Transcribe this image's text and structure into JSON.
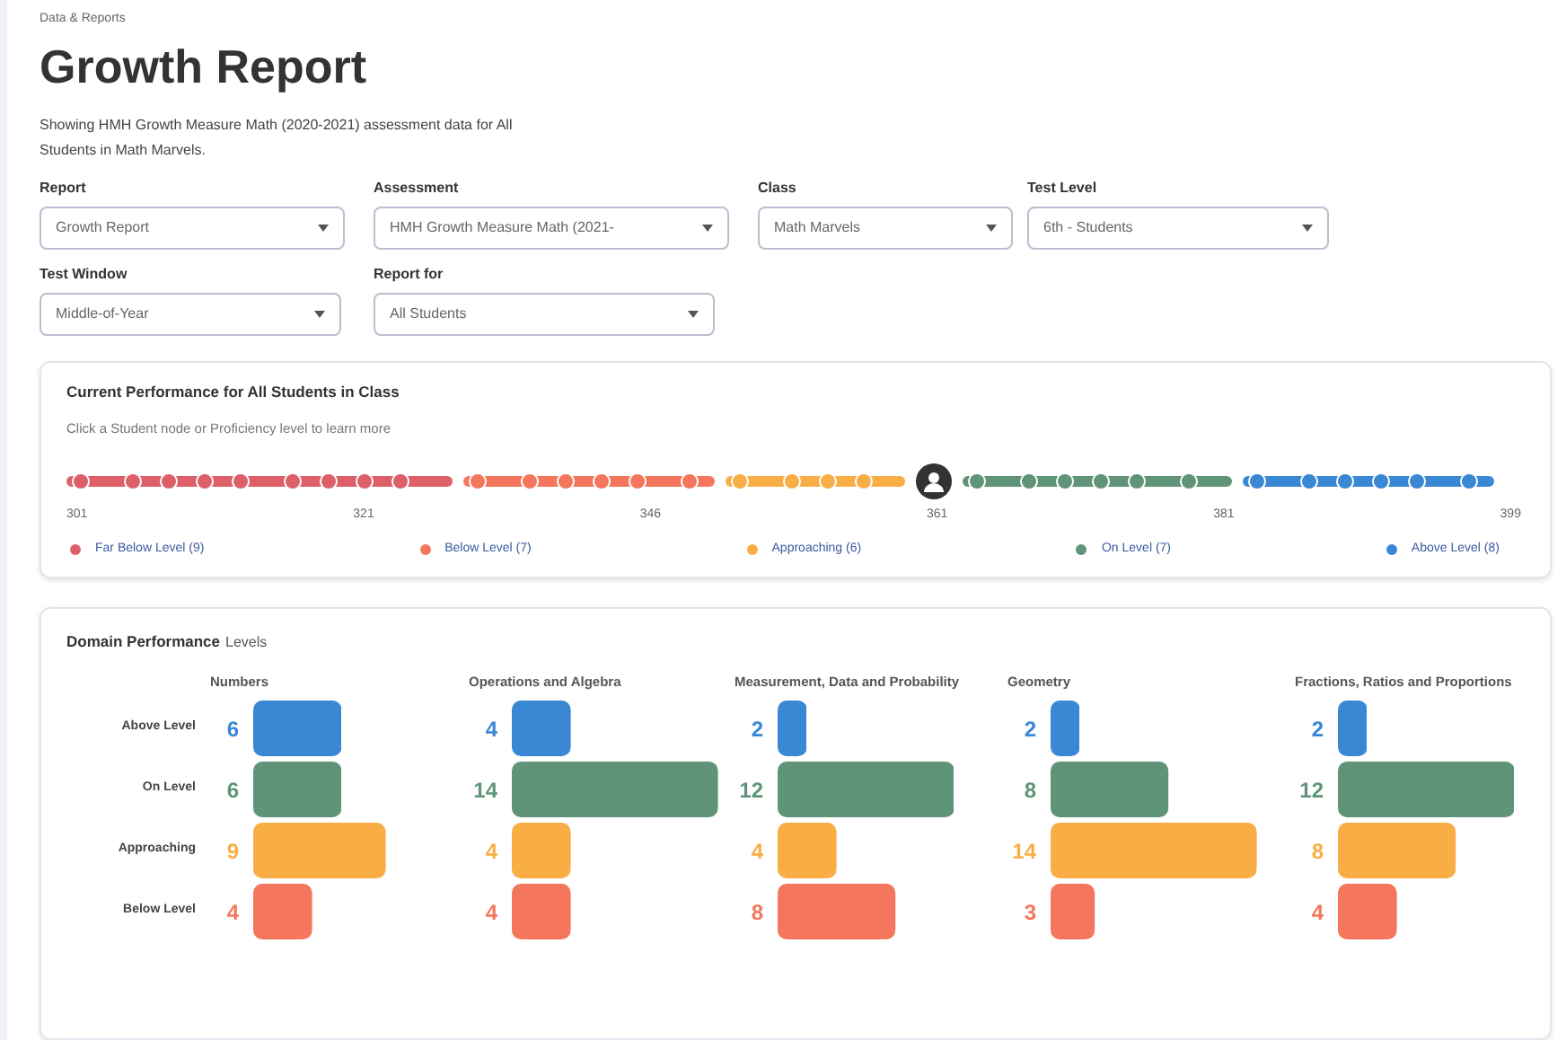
{
  "breadcrumb": "Data & Reports",
  "title": "Growth Report",
  "description": "Showing HMH Growth Measure Math (2020-2021) assessment data for All Students in Math Marvels.",
  "filters": [
    {
      "label": "Report",
      "value": "Growth Report"
    },
    {
      "label": "Assessment",
      "value": "HMH Growth Measure Math (2021-"
    },
    {
      "label": "Class",
      "value": "Math Marvels"
    },
    {
      "label": "Test Level",
      "value": "6th - Students"
    },
    {
      "label": "Test Window",
      "value": "Middle-of-Year"
    },
    {
      "label": "Report for",
      "value": "All Students"
    }
  ],
  "current_performance": {
    "title": "Current Performance for All Students in Class",
    "hint": "Click a Student node or Proficiency level to learn more",
    "axis_ticks": [
      "301",
      "321",
      "346",
      "361",
      "381",
      "399"
    ],
    "levels": [
      {
        "label": "Far Below Level (9)",
        "color": "#dd6068"
      },
      {
        "label": "Below Level (7)",
        "color": "#f4765c"
      },
      {
        "label": "Approaching (6)",
        "color": "#f9ad45"
      },
      {
        "label": "On Level (7)",
        "color": "#5f9478"
      },
      {
        "label": "Above Level (8)",
        "color": "#3a87d4"
      }
    ]
  },
  "domain_performance": {
    "title": "Domain Performance",
    "subtitle": "Levels",
    "rows": [
      {
        "color": "#3a87d4"
      },
      {
        "color": "#5f9478"
      },
      {
        "color": "#f9ad45"
      },
      {
        "color": "#f4765c"
      }
    ],
    "domains": [
      {
        "chart_data": {
          "type": "bar",
          "orientation": "horizontal",
          "title": "Numbers",
          "categories": [
            "Above Level",
            "On Level",
            "Approaching",
            "Below Level"
          ],
          "values": [
            6,
            6,
            9,
            4
          ],
          "data_labels": true
        }
      },
      {
        "chart_data": {
          "type": "bar",
          "orientation": "horizontal",
          "title": "Operations and Algebra",
          "values": [
            4,
            14,
            4,
            4
          ],
          "data_labels": true
        }
      },
      {
        "chart_data": {
          "type": "bar",
          "orientation": "horizontal",
          "title": "Measurement, Data and Probability",
          "values": [
            2,
            12,
            4,
            8
          ],
          "data_labels": true
        }
      },
      {
        "chart_data": {
          "type": "bar",
          "orientation": "horizontal",
          "title": "Geometry",
          "values": [
            2,
            8,
            14,
            3
          ],
          "data_labels": true
        }
      },
      {
        "chart_data": {
          "type": "bar",
          "orientation": "horizontal",
          "title": "Fractions, Ratios and Proportions",
          "values": [
            2,
            12,
            8,
            4
          ],
          "data_labels": true
        }
      }
    ]
  }
}
